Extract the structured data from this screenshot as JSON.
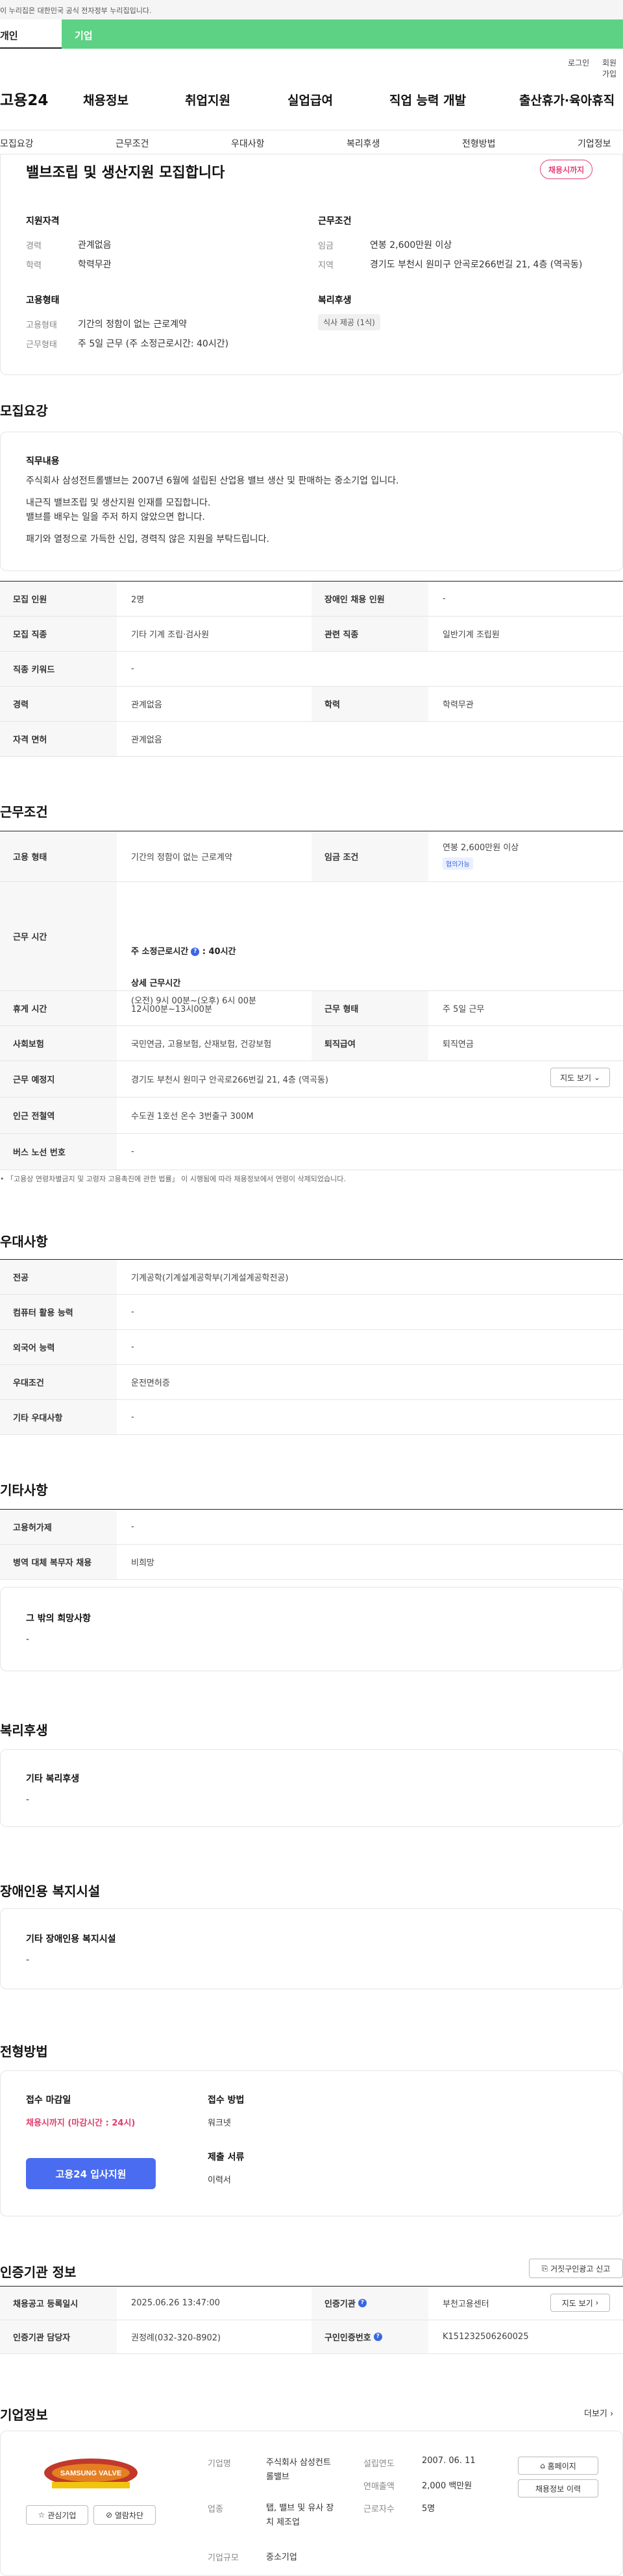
{
  "topbar": {
    "notice": "이 누리집은 대한민국 공식 전자정부 누리집입니다."
  },
  "tabs": {
    "personal": "개인",
    "company": "기업"
  },
  "util": {
    "login": "로그인",
    "join": "회원가입"
  },
  "header": {
    "logo": "고용24",
    "gnb": [
      "채용정보",
      "취업지원",
      "실업급여",
      "직업 능력 개발",
      "출산휴가·육아휴직"
    ]
  },
  "subnav": [
    "모집요강",
    "근무조건",
    "우대사항",
    "복리후생",
    "전형방법",
    "기업정보"
  ],
  "job": {
    "title": "밸브조립 및 생산지원 모집합니다",
    "badge": "채용시까지",
    "qual_head": "지원자격",
    "career_label": "경력",
    "career_value": "관계없음",
    "edu_label": "학력",
    "edu_value": "학력무관",
    "cond_head": "근무조건",
    "wage_label": "임금",
    "wage_value": "연봉 2,600만원 이상",
    "region_label": "지역",
    "region_value": "경기도 부천시 원미구 안곡로266번길 21, 4층 (역곡동)",
    "emp_head": "고용형태",
    "emptype_label": "고용형태",
    "emptype_value": "기간의 정함이 없는 근로계약",
    "worktype_label": "근무형태",
    "worktype_value": "주 5일 근무 (주 소정근로시간: 40시간)",
    "welfare_head": "복리후생",
    "welfare_chip": "식사 제공 (1식)"
  },
  "recruit": {
    "head": "모집요강",
    "duty_head": "직무내용",
    "duty_lines": [
      "주식회사 삼성전트롤밸브는 2007년 6월에 설립된 산업용 밸브 생산 및 판매하는 중소기업 입니다.",
      "",
      "내근직 밸브조립 및 생산지원 인재를 모집합니다.",
      "밸브를 배우는 일을 주저 하지 않았으면 합니다.",
      "",
      "패기와 열정으로 가득한 신입, 경력직 않은 지원을 부탁드립니다."
    ],
    "rows": [
      {
        "k1": "모집 인원",
        "v1": "2명",
        "k2": "장애인 채용 인원",
        "v2": "-"
      },
      {
        "k1": "모집 직종",
        "v1": "기타 기계 조립·검사원",
        "k2": "관련 직종",
        "v2": "일반기계 조립원"
      },
      {
        "k1": "직종 키워드",
        "v1": "-"
      },
      {
        "k1": "경력",
        "v1": "관계없음",
        "k2": "학력",
        "v2": "학력무관"
      },
      {
        "k1": "자격 면허",
        "v1": "관계없음"
      }
    ]
  },
  "work": {
    "head": "근무조건",
    "emptype_k": "고용 형태",
    "emptype_v": "기간의 정함이 없는 근로계약",
    "wage_k": "임금 조건",
    "wage_v": "연봉 2,600만원 이상",
    "wage_tag": "협의가능",
    "hours_k": "근무 시간",
    "hours_title": "주 소정근로시간",
    "hours_value": ": 40시간",
    "hours_detail_title": "상세 근무시간",
    "hours_detail": "(오전) 9시 00분~(오후) 6시 00분",
    "break_k": "휴게 시간",
    "break_v": "12시00분~13시00분",
    "form_k": "근무 형태",
    "form_v": "주 5일 근무",
    "ins_k": "사회보험",
    "ins_v": "국민연금, 고용보험, 산재보험, 건강보험",
    "ret_k": "퇴직급여",
    "ret_v": "퇴직연금",
    "place_k": "근무 예정지",
    "place_v": "경기도 부천시 원미구 안곡로266번길 21, 4층 (역곡동)",
    "map_btn": "지도 보기",
    "station_k": "인근 전철역",
    "station_v": "수도권 1호선 온수 3번출구 300M",
    "bus_k": "버스 노선 번호",
    "bus_v": "-",
    "note": "「고용상 연령차별금지 및 고령자 고용촉진에 관한 법률」 이 시행됨에 따라 채용정보에서 연령이 삭제되었습니다."
  },
  "pref": {
    "head": "우대사항",
    "rows": [
      {
        "k": "전공",
        "v": "기계공학(기계설계공학부(기계설계공학전공)"
      },
      {
        "k": "컴퓨터 활용 능력",
        "v": "-"
      },
      {
        "k": "외국어 능력",
        "v": "-"
      },
      {
        "k": "우대조건",
        "v": "운전면허증"
      },
      {
        "k": "기타 우대사항",
        "v": "-"
      }
    ]
  },
  "etc": {
    "head": "기타사항",
    "rows": [
      {
        "k": "고용허가제",
        "v": "-"
      },
      {
        "k": "병역 대체 복무자 채용",
        "v": "비희망"
      }
    ],
    "other_head": "그 밖의 희망사항",
    "other_value": "-"
  },
  "welfare": {
    "head": "복리후생",
    "sub": "기타 복리후생",
    "value": "-"
  },
  "disabled": {
    "head": "장애인용 복지시설",
    "sub": "기타 장애인용 복지시설",
    "value": "-"
  },
  "process": {
    "head": "전형방법",
    "deadline_head": "접수 마감일",
    "deadline_value": "채용시까지 (마감시간 : 24시)",
    "method_head": "접수 방법",
    "method_value": "워크넷",
    "apply_btn": "고용24 입사지원",
    "docs_head": "제출 서류",
    "docs_value": "이력서"
  },
  "cert": {
    "head": "인증기관 정보",
    "report_btn": "거짓구인광고 신고",
    "date_k": "채용공고 등록일시",
    "date_v": "2025.06.26 13:47:00",
    "org_k": "인증기관",
    "org_v": "부천고용센터",
    "map_btn": "지도 보기",
    "mgr_k": "인증기관 담당자",
    "mgr_v": "권정례(032-320-8902)",
    "no_k": "구인인증번호",
    "no_v": "K151232506260025"
  },
  "company": {
    "head": "기업정보",
    "more": "더보기",
    "logo_text": "SAMSUNG VALVE",
    "interest_btn": "관심기업",
    "block_btn": "열람차단",
    "name_k": "기업명",
    "name_v": "주식회사 삼성컨트롤밸브",
    "biz_k": "업종",
    "biz_v": "탭, 밸브 및 유사 장치 제조업",
    "size_k": "기업규모",
    "size_v": "중소기업",
    "est_k": "설립연도",
    "est_v": "2007. 06. 11",
    "sales_k": "연매출액",
    "sales_v": "2,000 백만원",
    "emp_k": "근로자수",
    "emp_v": "5명",
    "home_btn": "홈페이지",
    "history_btn": "채용정보 이력"
  }
}
